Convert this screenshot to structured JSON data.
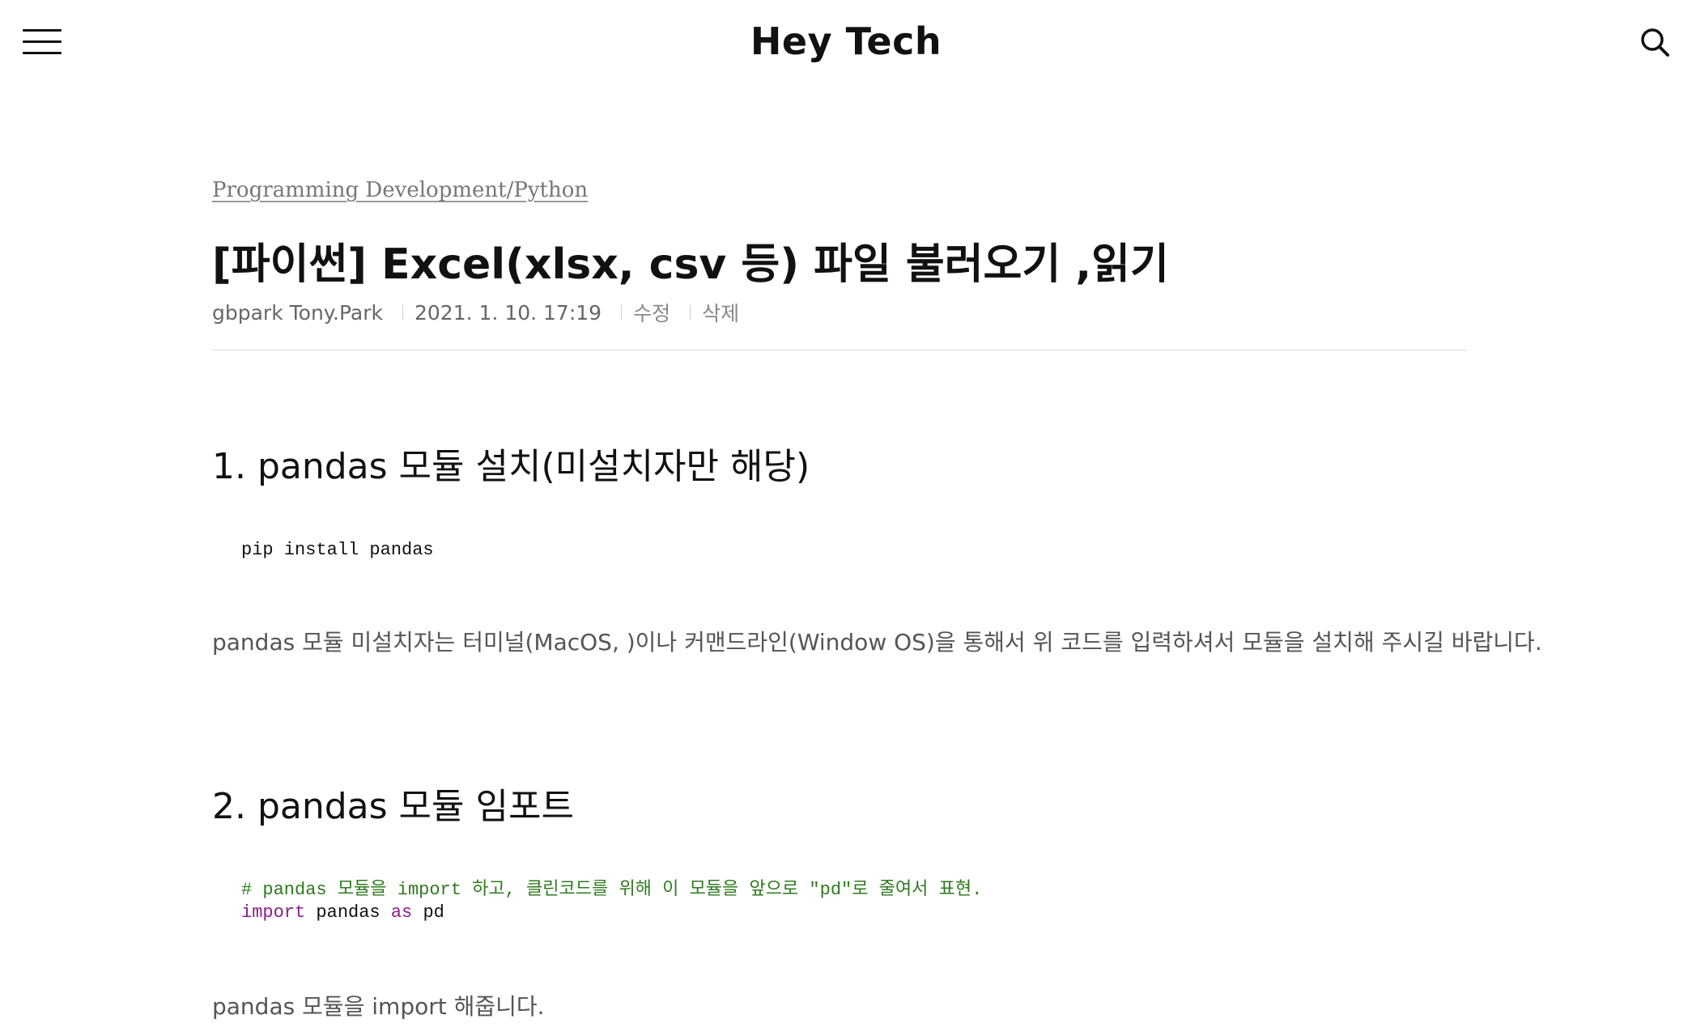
{
  "header": {
    "site_title": "Hey Tech",
    "menu_icon": "hamburger-menu-icon",
    "search_icon": "search-icon"
  },
  "article": {
    "category": "Programming Development/Python",
    "title": "[파이썬] Excel(xlsx, csv 등) 파일 불러오기 ,읽기",
    "meta": {
      "author": "gbpark Tony.Park",
      "date": "2021. 1. 10. 17:19",
      "edit_label": "수정",
      "delete_label": "삭제"
    },
    "sections": [
      {
        "heading": "1. pandas 모듈 설치(미설치자만 해당)",
        "code_line1": "pip install pandas",
        "paragraph": "pandas 모듈 미설치자는 터미널(MacOS, )이나 커맨드라인(Window OS)을 통해서 위 코드를 입력하셔서 모듈을 설치해 주시길 바랍니다."
      },
      {
        "heading": "2. pandas 모듈 임포트",
        "code_comment": "# pandas 모듈을 import 하고, 클린코드를 위해 이 모듈을 앞으로 \"pd\"로 줄여서 표현.",
        "code_kw_import": "import",
        "code_mid": " pandas ",
        "code_kw_as": "as",
        "code_end": " pd",
        "paragraph": "pandas 모듈을 import 해줍니다."
      }
    ]
  },
  "colors": {
    "comment": "#2f7a1f",
    "keyword": "#8a1f8a",
    "muted_text": "#555555"
  }
}
